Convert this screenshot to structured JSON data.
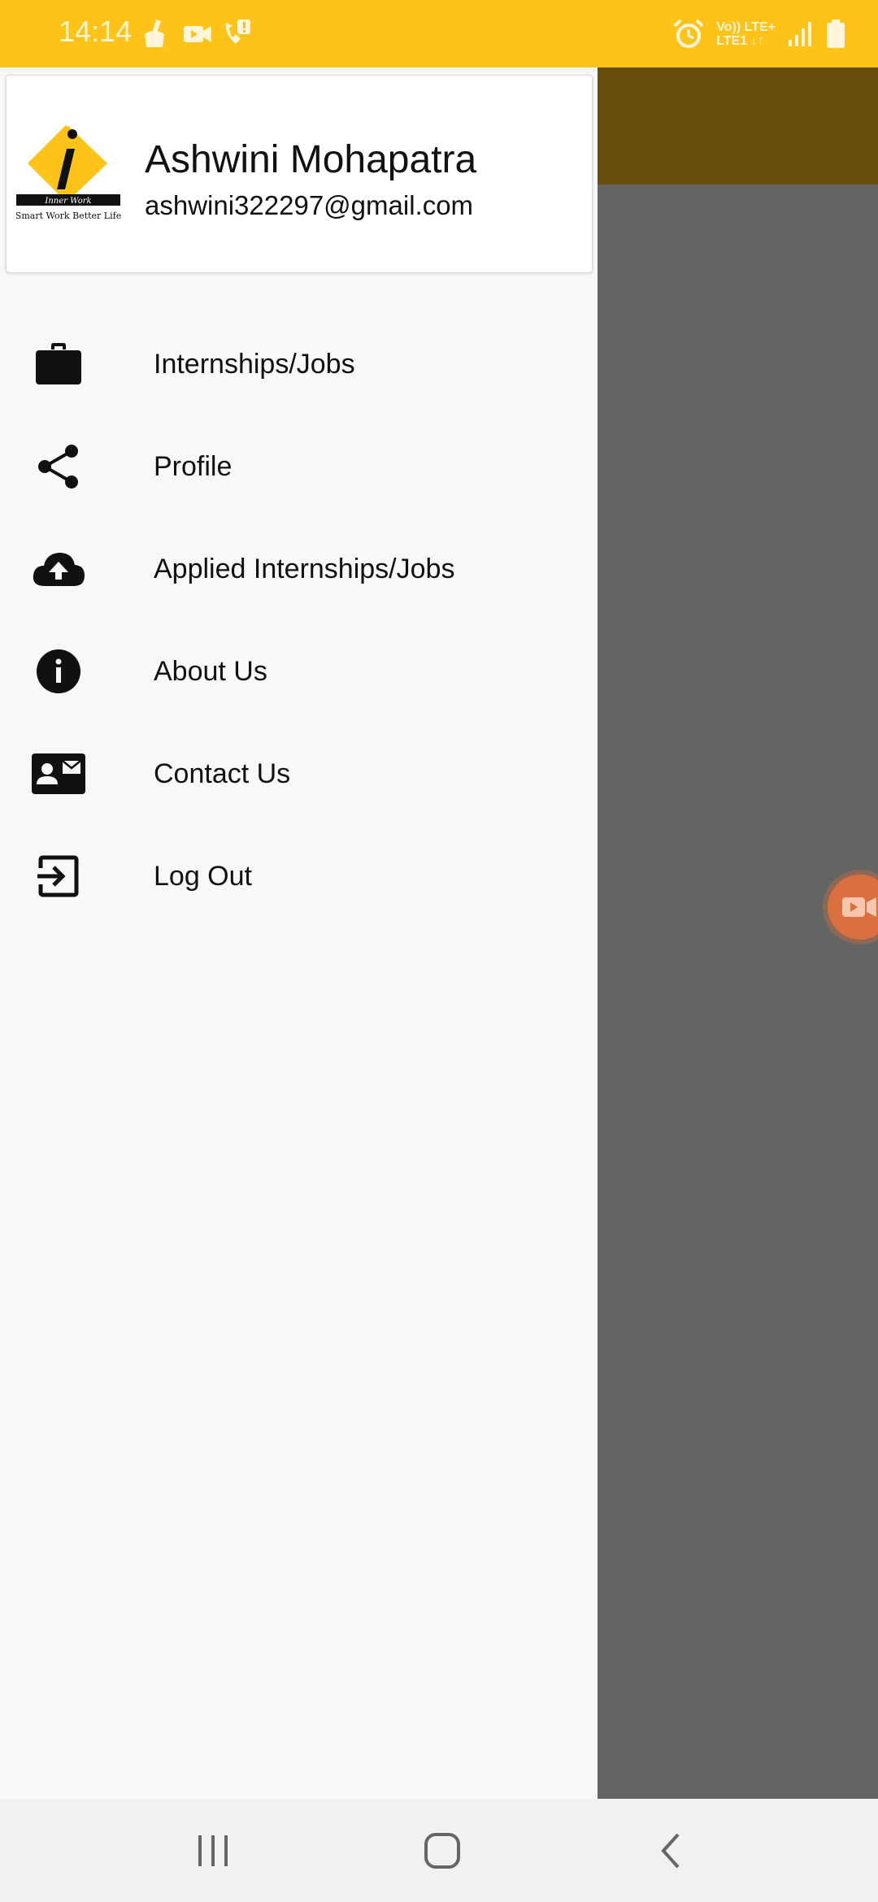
{
  "status_bar": {
    "time": "14:14",
    "network_line1": "Vo)) LTE+",
    "network_line2": "LTE1",
    "background": "#fdc318",
    "icons": [
      "cleaner-icon",
      "video-call-icon",
      "wifi-call-icon",
      "alarm-icon",
      "signal-icon",
      "battery-icon"
    ]
  },
  "drawer": {
    "header": {
      "logo_icon": "inner-work-logo",
      "logo_text_top": "Inner Work",
      "logo_text_bottom": "Smart Work Better Life",
      "user_name": "Ashwini Mohapatra",
      "user_email": "ashwini322297@gmail.com"
    },
    "items": [
      {
        "label": "Internships/Jobs",
        "icon": "briefcase-icon"
      },
      {
        "label": "Profile",
        "icon": "share-icon"
      },
      {
        "label": "Applied Internships/Jobs",
        "icon": "cloud-upload-icon"
      },
      {
        "label": "About Us",
        "icon": "info-icon"
      },
      {
        "label": "Contact Us",
        "icon": "contact-card-icon"
      },
      {
        "label": "Log Out",
        "icon": "logout-icon"
      }
    ]
  },
  "nav_bar": {
    "buttons": [
      "recents-button",
      "home-button",
      "back-button"
    ]
  },
  "colors": {
    "accent": "#fdc318",
    "toolbar_dimmed": "#654f0a",
    "scrim": "#646464",
    "recorder_bubble": "#d9703d"
  }
}
